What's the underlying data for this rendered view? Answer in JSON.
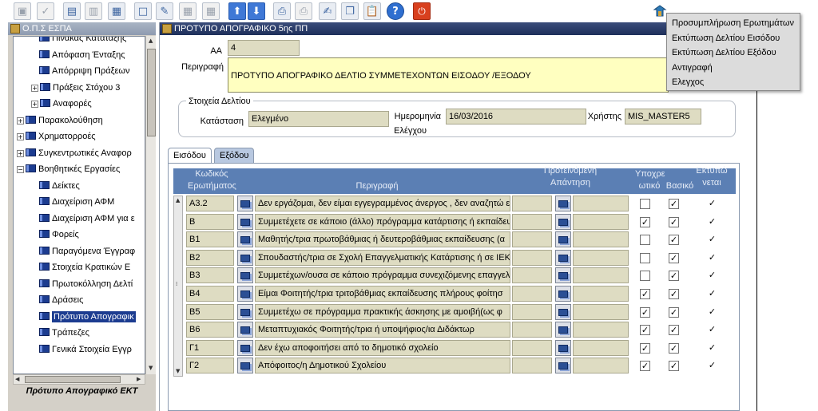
{
  "toolbar": {
    "buttons": [
      {
        "name": "save-icon",
        "glyph": "▣",
        "style": "dim"
      },
      {
        "name": "check-icon",
        "glyph": "✓",
        "style": "dim"
      },
      {
        "name": "insert-record-icon",
        "glyph": "▤",
        "style": ""
      },
      {
        "name": "delete-record-icon",
        "glyph": "▥",
        "style": "dim"
      },
      {
        "name": "duplicate-record-icon",
        "glyph": "▦",
        "style": ""
      },
      {
        "name": "new-document-icon",
        "glyph": "□",
        "style": ""
      },
      {
        "name": "edit-field-icon",
        "glyph": "✎",
        "style": ""
      },
      {
        "name": "grid-icon",
        "glyph": "▦",
        "style": "dim"
      },
      {
        "name": "table-icon",
        "glyph": "▦",
        "style": "dim"
      },
      {
        "name": "arrow-up-icon",
        "glyph": "⬆",
        "style": "blue"
      },
      {
        "name": "arrow-down-icon",
        "glyph": "⬇",
        "style": "blue"
      },
      {
        "name": "print-icon",
        "glyph": "⎙",
        "style": ""
      },
      {
        "name": "print-preview-icon",
        "glyph": "⎙",
        "style": "dim"
      },
      {
        "name": "edit-document-icon",
        "glyph": "✍",
        "style": ""
      },
      {
        "name": "copy-icon",
        "glyph": "❐",
        "style": ""
      },
      {
        "name": "paste-icon",
        "glyph": "📋",
        "style": ""
      },
      {
        "name": "help-icon",
        "glyph": "?",
        "style": "help"
      },
      {
        "name": "exit-icon",
        "glyph": "⏻",
        "style": "red"
      }
    ]
  },
  "nav": {
    "title": "Ο.Π.Σ ΕΣΠΑ",
    "items": [
      {
        "label": "Πίνακας Κατάταξης",
        "indent": 2,
        "expand": ""
      },
      {
        "label": "Απόφαση Ένταξης",
        "indent": 2,
        "expand": ""
      },
      {
        "label": "Απόρριψη Πράξεων",
        "indent": 2,
        "expand": ""
      },
      {
        "label": "Πράξεις Στόχου 3",
        "indent": 1,
        "expand": "+"
      },
      {
        "label": "Αναφορές",
        "indent": 1,
        "expand": "+"
      },
      {
        "label": "Παρακολούθηση",
        "indent": 0,
        "expand": "+"
      },
      {
        "label": "Χρηματορροές",
        "indent": 0,
        "expand": "+"
      },
      {
        "label": "Συγκεντρωτικές Αναφορ",
        "indent": 0,
        "expand": "+"
      },
      {
        "label": "Βοηθητικές Εργασίες",
        "indent": 0,
        "expand": "−"
      },
      {
        "label": "Δείκτες",
        "indent": 2,
        "expand": ""
      },
      {
        "label": "Διαχείριση ΑΦΜ",
        "indent": 2,
        "expand": ""
      },
      {
        "label": "Διαχείριση ΑΦΜ για ε",
        "indent": 2,
        "expand": ""
      },
      {
        "label": "Φορείς",
        "indent": 2,
        "expand": ""
      },
      {
        "label": "Παραγόμενα Έγγραφ",
        "indent": 2,
        "expand": ""
      },
      {
        "label": "Στοιχεία Κρατικών Ε",
        "indent": 2,
        "expand": ""
      },
      {
        "label": "Πρωτοκόλληση Δελτί",
        "indent": 2,
        "expand": ""
      },
      {
        "label": "Δράσεις",
        "indent": 2,
        "expand": ""
      },
      {
        "label": "Πρότυπο Απογραφικ",
        "indent": 2,
        "expand": "",
        "selected": true
      },
      {
        "label": "Τράπεζες",
        "indent": 2,
        "expand": ""
      },
      {
        "label": "Γενικά Στοιχεία Εγγρ",
        "indent": 2,
        "expand": ""
      }
    ],
    "footer": "Πρότυπο Απογραφικό ΕΚΤ"
  },
  "main": {
    "title": "ΠΡΟΤΥΠΟ ΑΠΟΓΡΑΦΙΚΟ 5ης ΠΠ",
    "aa_label": "ΑΑ",
    "aa_value": "4",
    "desc_label": "Περιγραφή",
    "desc_value": "ΠΡΟΤΥΠΟ ΑΠΟΓΡΑΦΙΚΟ ΔΕΛΤΙΟ ΣΥΜΜΕΤΕΧΟΝΤΩΝ  ΕΙΣΟΔΟΥ /ΕΞΟΔΟΥ",
    "section_title": "Στοιχεία Δελτίου",
    "status_label": "Κατάσταση",
    "status_value": "Ελεγμένο",
    "date_label_1": "Ημερομηνία",
    "date_label_2": "Ελέγχου",
    "date_value": "16/03/2016",
    "user_label": "Χρήστης",
    "user_value": "MIS_MASTER5"
  },
  "tabs": [
    {
      "label": "Εισόδου",
      "active": true
    },
    {
      "label": "Εξόδου",
      "active": false
    }
  ],
  "grid": {
    "headers": {
      "code_1": "Κωδικός",
      "code_2": "Ερωτήματος",
      "description": "Περιγραφή",
      "answer_1": "Προτεινόμενη",
      "answer_2": "Απάντηση",
      "mandatory_1": "Υποχρε",
      "mandatory_2": "ωτικό",
      "basic": "Βασικό",
      "printed_1": "Εκτυπώ",
      "printed_2": "νεται"
    },
    "rows": [
      {
        "code": "Α3.2",
        "desc": "Δεν εργάζομαι, δεν είμαι εγγεγραμμένος άνεργος , δεν αναζητώ εργασία",
        "answer": "",
        "mandatory": false,
        "basic": true,
        "printed": true
      },
      {
        "code": "Β",
        "desc": "Συμμετέχετε σε κάποιο (άλλο) πρόγραμμα κατάρτισης ή εκπαίδευσης",
        "answer": "",
        "mandatory": true,
        "basic": true,
        "printed": true
      },
      {
        "code": "Β1",
        "desc": "Μαθητής/τρια πρωτοβάθμιας ή δευτεροβάθμιας εκπαίδευσης (α",
        "answer": "",
        "mandatory": false,
        "basic": true,
        "printed": true
      },
      {
        "code": "Β2",
        "desc": "Σπουδαστής/τρια σε Σχολή Επαγγελματικής Κατάρτισης ή σε ΙΕΚ",
        "answer": "",
        "mandatory": false,
        "basic": true,
        "printed": true
      },
      {
        "code": "Β3",
        "desc": "Συμμετέχων/ουσα σε κάποιο πρόγραμμα συνεχιζόμενης επαγγελ",
        "answer": "",
        "mandatory": false,
        "basic": true,
        "printed": true
      },
      {
        "code": "Β4",
        "desc": "Είμαι Φοιτητής/τρια τριτοβάθμιας εκπαίδευσης πλήρους φοίτησ",
        "answer": "",
        "mandatory": true,
        "basic": true,
        "printed": true
      },
      {
        "code": "Β5",
        "desc": "Συμμετέχω σε πρόγραμμα πρακτικής  άσκησης με αμοιβή(ως φ",
        "answer": "",
        "mandatory": true,
        "basic": true,
        "printed": true
      },
      {
        "code": "Β6",
        "desc": "Μεταπτυχιακός Φοιτητής/τρια ή    υποψήφιος/ια  Διδάκτωρ",
        "answer": "",
        "mandatory": true,
        "basic": true,
        "printed": true
      },
      {
        "code": "Γ1",
        "desc": "Δεν έχω αποφοιτήσει από το δημοτικό σχολείο",
        "answer": "",
        "mandatory": true,
        "basic": true,
        "printed": true
      },
      {
        "code": "Γ2",
        "desc": "Απόφοιτος/η  Δημοτικού Σχολείου",
        "answer": "",
        "mandatory": true,
        "basic": true,
        "printed": true
      }
    ]
  },
  "menu": {
    "items": [
      "Προσυμπλήρωση Ερωτημάτων",
      "Εκτύπωση Δελτίου Εισόδου",
      "Εκτύπωση Δελτίου Εξόδου",
      "Αντιγραφή",
      "Ελεγχος"
    ]
  },
  "menu_trigger_icon": "tools-icon",
  "colors": {
    "header_blue": "#5b7fb4",
    "field_khaki": "#dedcc2",
    "field_yellow": "#ffffc0",
    "title_bar": "#1e2f5a",
    "selected_nav": "#1c3c90"
  }
}
